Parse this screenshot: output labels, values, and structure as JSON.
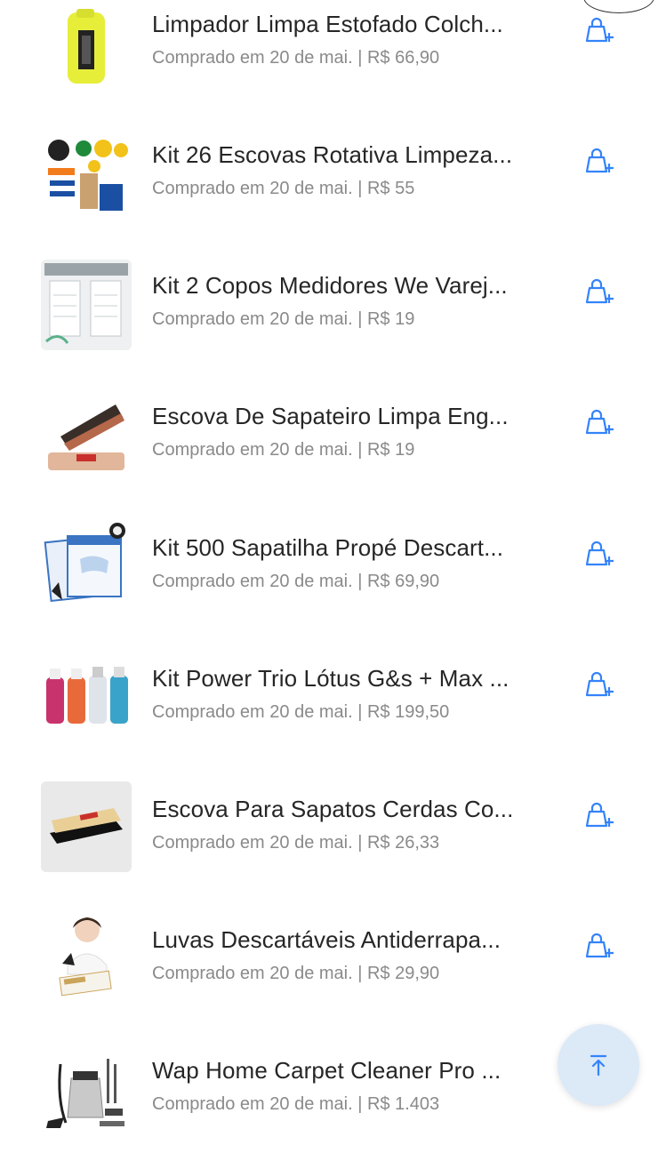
{
  "accent_color": "#3483fa",
  "items": [
    {
      "title": "Limpador Limpa Estofado Colch...",
      "meta": "Comprado em 20 de mai. | R$ 66,90",
      "thumb": "yellow-bottle"
    },
    {
      "title": "Kit 26 Escovas Rotativa Limpeza...",
      "meta": "Comprado em 20 de mai. | R$ 55",
      "thumb": "brush-kit"
    },
    {
      "title": "Kit 2 Copos Medidores We Varej...",
      "meta": "Comprado em 20 de mai. | R$ 19",
      "thumb": "measuring-cups"
    },
    {
      "title": "Escova De Sapateiro Limpa Eng...",
      "meta": "Comprado em 20 de mai. | R$ 19",
      "thumb": "shoe-brush"
    },
    {
      "title": "Kit 500 Sapatilha Propé Descart...",
      "meta": "Comprado em 20 de mai. | R$ 69,90",
      "thumb": "shoe-covers"
    },
    {
      "title": "Kit Power Trio Lótus G&s + Max ...",
      "meta": "Comprado em 20 de mai. | R$ 199,50",
      "thumb": "bottles"
    },
    {
      "title": "Escova Para Sapatos Cerdas Co...",
      "meta": "Comprado em 20 de mai. | R$ 26,33",
      "thumb": "wood-brush"
    },
    {
      "title": "Luvas Descartáveis Antiderrapa...",
      "meta": "Comprado em 20 de mai. | R$ 29,90",
      "thumb": "gloves"
    },
    {
      "title": "Wap Home Carpet Cleaner Pro ...",
      "meta": "Comprado em 20 de mai. | R$ 1.403",
      "thumb": "vacuum"
    }
  ],
  "icons": {
    "cart": "add-to-cart-icon",
    "scroll_top": "arrow-up-icon"
  }
}
